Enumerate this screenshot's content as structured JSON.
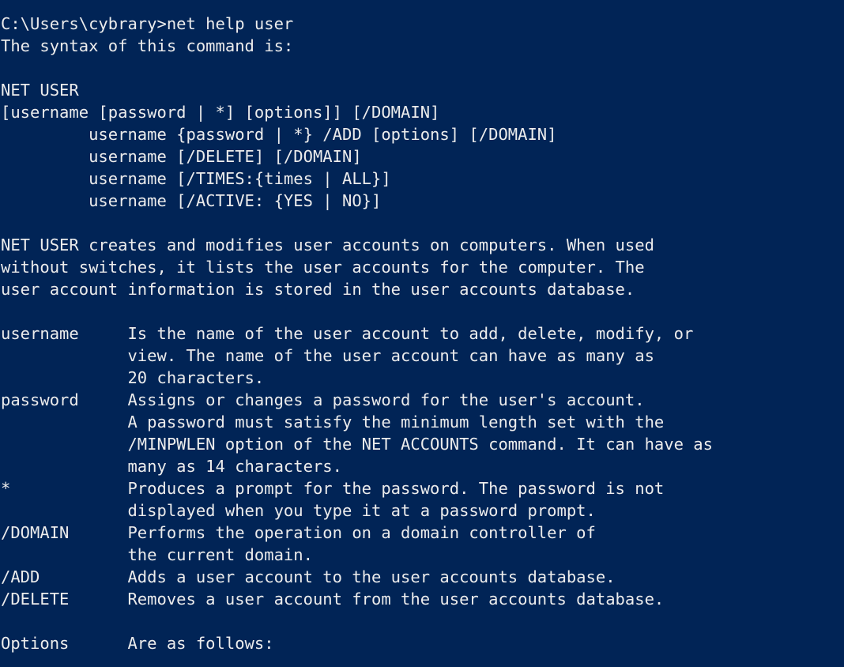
{
  "theme": {
    "background": "#012456",
    "foreground": "#ececec"
  },
  "console": {
    "lines": [
      "C:\\Users\\cybrary>net help user",
      "The syntax of this command is:",
      "",
      "NET USER",
      "[username [password | *] [options]] [/DOMAIN]",
      "         username {password | *} /ADD [options] [/DOMAIN]",
      "         username [/DELETE] [/DOMAIN]",
      "         username [/TIMES:{times | ALL}]",
      "         username [/ACTIVE: {YES | NO}]",
      "",
      "NET USER creates and modifies user accounts on computers. When used",
      "without switches, it lists the user accounts for the computer. The",
      "user account information is stored in the user accounts database.",
      "",
      "username     Is the name of the user account to add, delete, modify, or",
      "             view. The name of the user account can have as many as",
      "             20 characters.",
      "password     Assigns or changes a password for the user's account.",
      "             A password must satisfy the minimum length set with the",
      "             /MINPWLEN option of the NET ACCOUNTS command. It can have as",
      "             many as 14 characters.",
      "*            Produces a prompt for the password. The password is not",
      "             displayed when you type it at a password prompt.",
      "/DOMAIN      Performs the operation on a domain controller of",
      "             the current domain.",
      "/ADD         Adds a user account to the user accounts database.",
      "/DELETE      Removes a user account from the user accounts database.",
      "",
      "Options      Are as follows:"
    ]
  }
}
